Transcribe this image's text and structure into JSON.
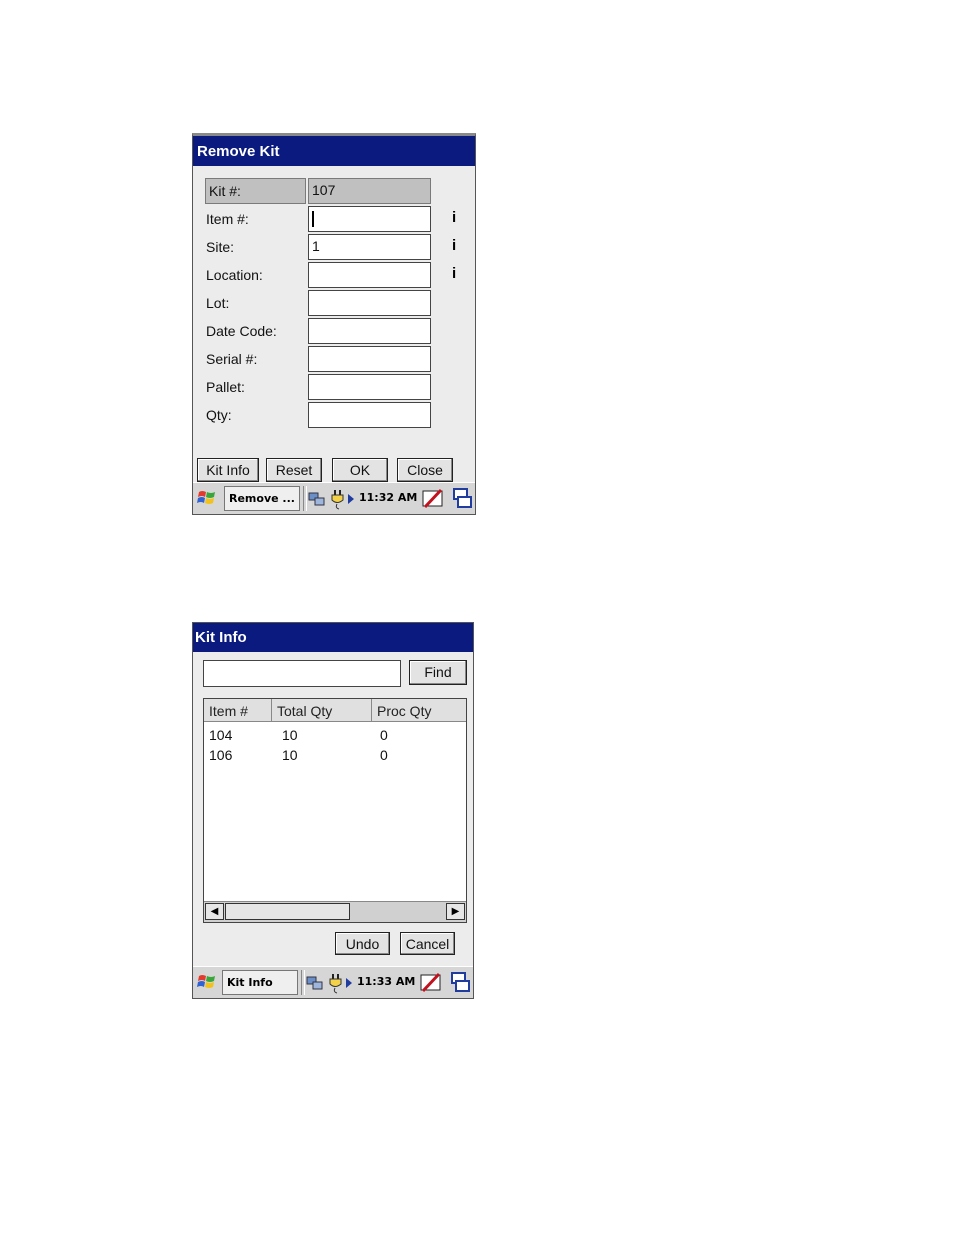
{
  "remove_kit": {
    "title": "Remove Kit",
    "fields": [
      {
        "label": "Kit #:",
        "value": "107"
      },
      {
        "label": "Item #:",
        "value": ""
      },
      {
        "label": "Site:",
        "value": "1"
      },
      {
        "label": "Location:",
        "value": ""
      },
      {
        "label": "Lot:",
        "value": ""
      },
      {
        "label": "Date Code:",
        "value": ""
      },
      {
        "label": "Serial #:",
        "value": ""
      },
      {
        "label": "Pallet:",
        "value": ""
      },
      {
        "label": "Qty:",
        "value": ""
      }
    ],
    "info_glyph": "i",
    "buttons": {
      "kit_info": "Kit Info",
      "reset": "Reset",
      "ok": "OK",
      "close": "Close"
    },
    "taskbar": {
      "task": "Remove ...",
      "time": "11:32 AM"
    }
  },
  "kit_info": {
    "title": "Kit Info",
    "search_value": "",
    "find_button": "Find",
    "columns": [
      "Item #",
      "Total Qty",
      "Proc Qty"
    ],
    "rows": [
      [
        "104",
        "10",
        "0"
      ],
      [
        "106",
        "10",
        "0"
      ]
    ],
    "buttons": {
      "undo": "Undo",
      "cancel": "Cancel"
    },
    "taskbar": {
      "task": "Kit Info",
      "time": "11:33 AM"
    }
  },
  "icons": {
    "start": "windows-flag-icon",
    "tray": [
      "network-icon",
      "power-plug-icon",
      "tray-arrow-icon",
      "input-panel-icon",
      "desktop-switch-icon"
    ]
  }
}
